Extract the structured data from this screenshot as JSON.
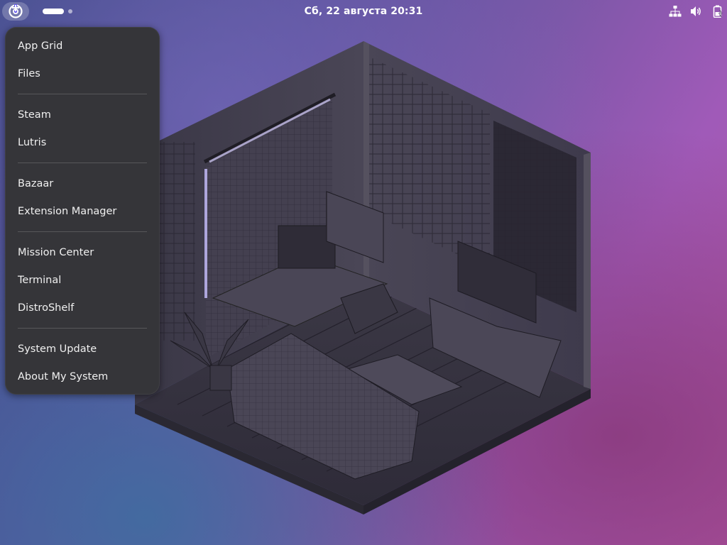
{
  "topbar": {
    "clock": "Сб, 22 августа  20:31",
    "activities_icon": "distro-logo-icon",
    "tray_icons": [
      "network-wired-icon",
      "volume-icon",
      "battery-icon"
    ]
  },
  "menu": {
    "groups": [
      [
        "App Grid",
        "Files"
      ],
      [
        "Steam",
        "Lutris"
      ],
      [
        "Bazaar",
        "Extension Manager"
      ],
      [
        "Mission Center",
        "Terminal",
        "DistroShelf"
      ],
      [
        "System Update",
        "About My System"
      ]
    ]
  },
  "colors": {
    "menu_bg": "#353539",
    "menu_text": "#f0f0f0",
    "panel_text": "#ffffff",
    "activities_accent": "#6a5cf0"
  }
}
